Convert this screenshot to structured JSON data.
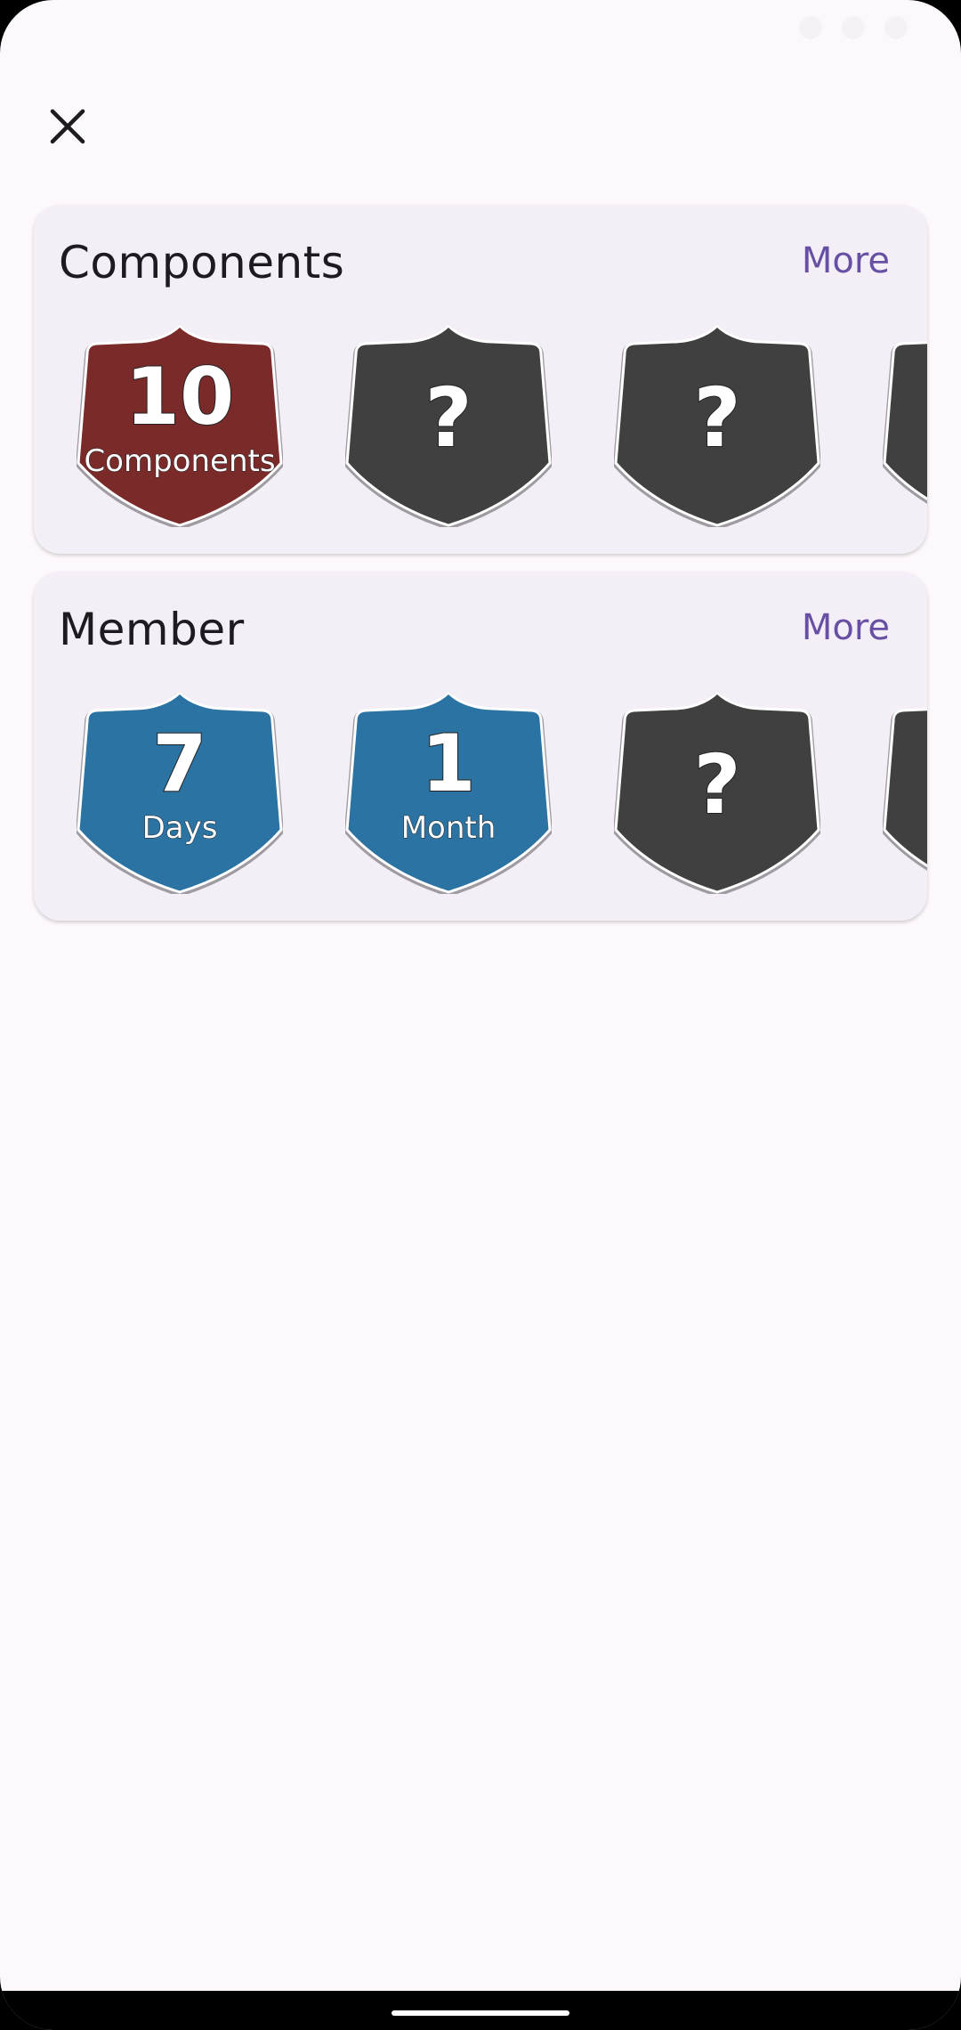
{
  "status": {
    "time": ""
  },
  "header": {
    "close_icon": "close-icon"
  },
  "sections": [
    {
      "title": "Components",
      "more_label": "More",
      "badges": [
        {
          "state": "earned",
          "color": "#7b2a2a",
          "value": "10",
          "label": "Components"
        },
        {
          "state": "locked",
          "color": "#404040",
          "value": "?",
          "label": ""
        },
        {
          "state": "locked",
          "color": "#404040",
          "value": "?",
          "label": ""
        },
        {
          "state": "locked",
          "color": "#404040",
          "value": "",
          "label": ""
        }
      ]
    },
    {
      "title": "Member",
      "more_label": "More",
      "badges": [
        {
          "state": "earned",
          "color": "#2a73a3",
          "value": "7",
          "label": "Days"
        },
        {
          "state": "earned",
          "color": "#2a73a3",
          "value": "1",
          "label": "Month"
        },
        {
          "state": "locked",
          "color": "#404040",
          "value": "?",
          "label": ""
        },
        {
          "state": "locked",
          "color": "#404040",
          "value": "",
          "label": ""
        }
      ]
    }
  ],
  "colors": {
    "background": "#fdf8fb",
    "card": "#f4eff7",
    "accent": "#6750a4",
    "locked_badge": "#404040",
    "components_badge": "#7b2a2a",
    "member_badge": "#2a73a3"
  }
}
